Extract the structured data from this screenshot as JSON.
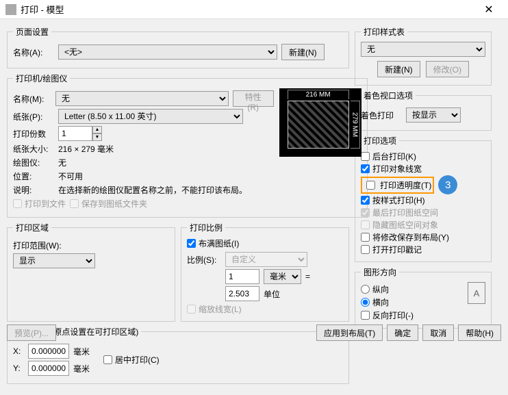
{
  "window": {
    "title": "打印 - 模型"
  },
  "pageSetup": {
    "legend": "页面设置",
    "nameLabel": "名称(A):",
    "nameValue": "<无>",
    "newBtn": "新建(N)"
  },
  "printer": {
    "legend": "打印机/绘图仪",
    "nameLabel": "名称(M):",
    "nameValue": "无",
    "propsBtn": "特性(R)",
    "paperLabel": "纸张(P):",
    "paperValue": "Letter (8.50 x 11.00 英寸)",
    "copiesLabel": "打印份数",
    "copiesValue": "1",
    "sizeLabel": "纸张大小:",
    "sizeValue": "216 × 279 毫米",
    "plotterLabel": "绘图仪:",
    "plotterValue": "无",
    "locationLabel": "位置:",
    "locationValue": "不可用",
    "descLabel": "说明:",
    "descValue": "在选择新的绘图仪配置名称之前，不能打印该布局。",
    "toFile": "打印到文件",
    "saveLines": "保存到图纸文件夹",
    "previewTop": "216 MM",
    "previewSide": "279 MM"
  },
  "area": {
    "legend": "打印区域",
    "rangeLabel": "打印范围(W):",
    "rangeValue": "显示"
  },
  "scale": {
    "legend": "打印比例",
    "fitLabel": "布满图纸(I)",
    "ratioLabel": "比例(S):",
    "ratioValue": "自定义",
    "unitValue": "1",
    "unitSelect": "毫米",
    "equals": "=",
    "drawingUnits": "2.503",
    "unitLabel": "单位",
    "scaleLW": "缩放线宽(L)"
  },
  "offset": {
    "legend": "打印偏移 (原点设置在可打印区域)",
    "xLabel": "X:",
    "yLabel": "Y:",
    "xValue": "0.000000",
    "yValue": "0.000000",
    "unit": "毫米",
    "center": "居中打印(C)"
  },
  "styleTable": {
    "legend": "打印样式表",
    "value": "无",
    "newBtn": "新建(N)",
    "editBtn": "修改(O)"
  },
  "shadedViewport": {
    "legend": "着色视口选项",
    "label": "着色打印",
    "value": "按显示"
  },
  "options": {
    "legend": "打印选项",
    "background": "后台打印(K)",
    "lineweights": "打印对象线宽",
    "transparency": "打印透明度(T)",
    "plotStyles": "按样式打印(H)",
    "paperspaceLast": "最后打印图纸空间",
    "hidePaperspace": "隐藏图纸空间对象",
    "saveChanges": "将修改保存到布局(Y)",
    "stamp": "打开打印戳记"
  },
  "orientation": {
    "legend": "图形方向",
    "portrait": "纵向",
    "landscape": "横向",
    "upsideDown": "反向打印(-)"
  },
  "footer": {
    "preview": "预览(P)...",
    "applyLayout": "应用到布局(T)",
    "ok": "确定",
    "cancel": "取消",
    "help": "帮助(H)"
  },
  "badge": "3"
}
